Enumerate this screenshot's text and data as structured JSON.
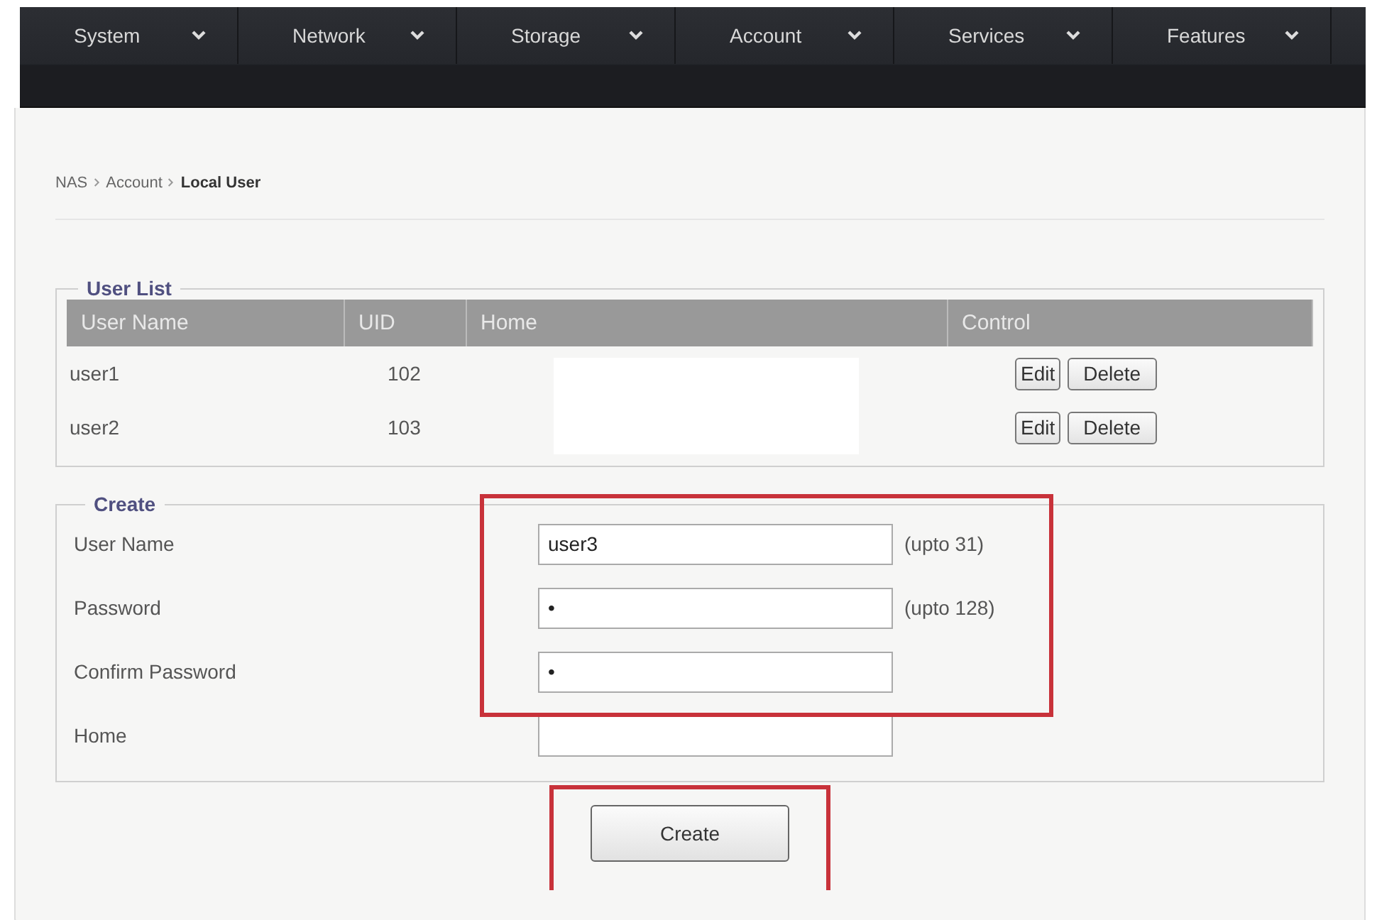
{
  "nav": [
    {
      "label": "System"
    },
    {
      "label": "Network"
    },
    {
      "label": "Storage"
    },
    {
      "label": "Account"
    },
    {
      "label": "Services"
    },
    {
      "label": "Features"
    }
  ],
  "breadcrumb": {
    "parts": [
      "NAS",
      "Account"
    ],
    "current": "Local User"
  },
  "user_list": {
    "title": "User List",
    "columns": [
      "User Name",
      "UID",
      "Home",
      "Control"
    ],
    "rows": [
      {
        "name": "user1",
        "uid": "102",
        "actions": [
          "Edit",
          "Delete"
        ]
      },
      {
        "name": "user2",
        "uid": "103",
        "actions": [
          "Edit",
          "Delete"
        ]
      }
    ]
  },
  "create": {
    "title": "Create",
    "fields_highlighted": true,
    "fields": [
      {
        "label": "User Name",
        "value": "user3",
        "hint": "(upto 31)"
      },
      {
        "label": "Password",
        "value": "•",
        "hint": "(upto 128)"
      },
      {
        "label": "Confirm Password",
        "value": "•"
      },
      {
        "label": "Home"
      }
    ],
    "button": {
      "label": "Create",
      "highlighted": true
    }
  }
}
